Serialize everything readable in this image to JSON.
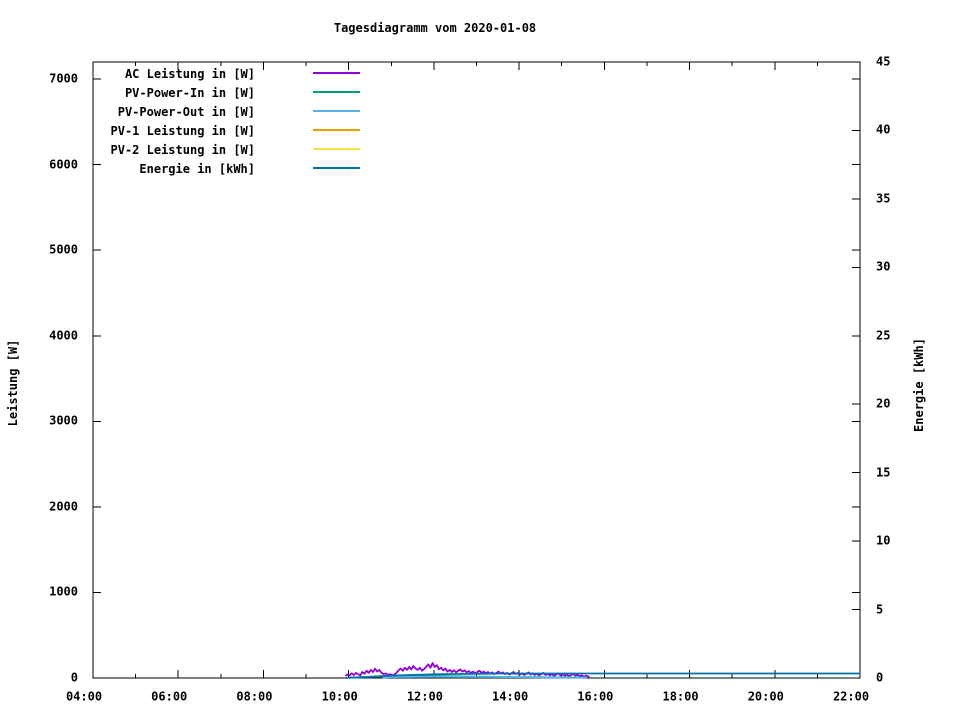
{
  "title": "Tagesdiagramm vom 2020-01-08",
  "axes": {
    "x": {
      "tick_labels": [
        "04:00",
        "06:00",
        "08:00",
        "10:00",
        "12:00",
        "14:00",
        "16:00",
        "18:00",
        "20:00",
        "22:00"
      ],
      "labeled_hours": [
        4,
        6,
        8,
        10,
        12,
        14,
        16,
        18,
        20,
        22
      ],
      "minor_hours": [
        5,
        7,
        9,
        11,
        13,
        15,
        17,
        19,
        21
      ],
      "range_hours": [
        4,
        22
      ]
    },
    "y_left": {
      "label": "Leistung [W]",
      "tick_labels": [
        "0",
        "1000",
        "2000",
        "3000",
        "4000",
        "5000",
        "6000",
        "7000"
      ],
      "tick_values": [
        0,
        1000,
        2000,
        3000,
        4000,
        5000,
        6000,
        7000
      ],
      "range": [
        0,
        7200
      ]
    },
    "y_right": {
      "label": "Energie [kWh]",
      "tick_labels": [
        "0",
        "5",
        "10",
        "15",
        "20",
        "25",
        "30",
        "35",
        "40",
        "45"
      ],
      "tick_values": [
        0,
        5,
        10,
        15,
        20,
        25,
        30,
        35,
        40,
        45
      ],
      "range": [
        0,
        45
      ]
    }
  },
  "colors": {
    "axis": "#000000",
    "background": "#ffffff",
    "ac": "#9400d3",
    "pv_in": "#009e73",
    "pv_out": "#56b4e9",
    "pv1": "#e69f00",
    "pv2": "#f0e442",
    "energie": "#0072b2"
  },
  "chart_data": {
    "type": "line",
    "title": "Tagesdiagramm vom 2020-01-08",
    "xlabel": "",
    "x_unit": "time of day (hours)",
    "xlim": [
      4,
      22
    ],
    "ylabel_left": "Leistung [W]",
    "ylim_left": [
      0,
      7200
    ],
    "ylabel_right": "Energie [kWh]",
    "ylim_right": [
      0,
      45
    ],
    "grid": false,
    "legend_position": "inside top-left",
    "series": [
      {
        "key": "ac",
        "name": "AC Leistung in [W]",
        "color": "#9400d3",
        "axis": "left",
        "points": [
          [
            9.92,
            25
          ],
          [
            9.97,
            40
          ],
          [
            10.02,
            30
          ],
          [
            10.07,
            55
          ],
          [
            10.12,
            35
          ],
          [
            10.17,
            60
          ],
          [
            10.22,
            45
          ],
          [
            10.27,
            30
          ],
          [
            10.32,
            70
          ],
          [
            10.37,
            50
          ],
          [
            10.42,
            85
          ],
          [
            10.47,
            60
          ],
          [
            10.52,
            95
          ],
          [
            10.57,
            70
          ],
          [
            10.62,
            110
          ],
          [
            10.67,
            75
          ],
          [
            10.72,
            95
          ],
          [
            10.77,
            60
          ],
          [
            10.82,
            45
          ],
          [
            10.87,
            55
          ],
          [
            10.92,
            35
          ],
          [
            10.97,
            45
          ],
          [
            11.02,
            30
          ],
          [
            11.07,
            40
          ],
          [
            11.12,
            60
          ],
          [
            11.17,
            90
          ],
          [
            11.22,
            110
          ],
          [
            11.27,
            85
          ],
          [
            11.32,
            120
          ],
          [
            11.37,
            95
          ],
          [
            11.42,
            130
          ],
          [
            11.47,
            100
          ],
          [
            11.52,
            140
          ],
          [
            11.57,
            110
          ],
          [
            11.62,
            95
          ],
          [
            11.67,
            120
          ],
          [
            11.72,
            85
          ],
          [
            11.77,
            105
          ],
          [
            11.82,
            130
          ],
          [
            11.87,
            160
          ],
          [
            11.92,
            120
          ],
          [
            11.97,
            175
          ],
          [
            12.02,
            130
          ],
          [
            12.07,
            150
          ],
          [
            12.12,
            100
          ],
          [
            12.17,
            120
          ],
          [
            12.22,
            90
          ],
          [
            12.27,
            110
          ],
          [
            12.32,
            75
          ],
          [
            12.37,
            95
          ],
          [
            12.42,
            70
          ],
          [
            12.47,
            90
          ],
          [
            12.52,
            65
          ],
          [
            12.57,
            85
          ],
          [
            12.62,
            100
          ],
          [
            12.67,
            75
          ],
          [
            12.72,
            90
          ],
          [
            12.77,
            65
          ],
          [
            12.82,
            80
          ],
          [
            12.87,
            60
          ],
          [
            12.92,
            75
          ],
          [
            12.97,
            55
          ],
          [
            13.02,
            70
          ],
          [
            13.07,
            85
          ],
          [
            13.12,
            60
          ],
          [
            13.17,
            75
          ],
          [
            13.22,
            55
          ],
          [
            13.27,
            70
          ],
          [
            13.32,
            50
          ],
          [
            13.37,
            65
          ],
          [
            13.42,
            45
          ],
          [
            13.47,
            60
          ],
          [
            13.52,
            75
          ],
          [
            13.57,
            50
          ],
          [
            13.62,
            65
          ],
          [
            13.67,
            45
          ],
          [
            13.72,
            60
          ],
          [
            13.77,
            40
          ],
          [
            13.82,
            55
          ],
          [
            13.87,
            70
          ],
          [
            13.92,
            45
          ],
          [
            13.97,
            60
          ],
          [
            14.02,
            40
          ],
          [
            14.07,
            55
          ],
          [
            14.12,
            35
          ],
          [
            14.17,
            50
          ],
          [
            14.22,
            65
          ],
          [
            14.27,
            40
          ],
          [
            14.32,
            55
          ],
          [
            14.37,
            35
          ],
          [
            14.42,
            50
          ],
          [
            14.47,
            30
          ],
          [
            14.52,
            45
          ],
          [
            14.57,
            60
          ],
          [
            14.62,
            35
          ],
          [
            14.67,
            50
          ],
          [
            14.72,
            30
          ],
          [
            14.77,
            45
          ],
          [
            14.82,
            25
          ],
          [
            14.87,
            40
          ],
          [
            14.92,
            55
          ],
          [
            14.97,
            30
          ],
          [
            15.02,
            45
          ],
          [
            15.07,
            25
          ],
          [
            15.12,
            40
          ],
          [
            15.17,
            20
          ],
          [
            15.22,
            35
          ],
          [
            15.27,
            50
          ],
          [
            15.32,
            25
          ],
          [
            15.37,
            40
          ],
          [
            15.42,
            20
          ],
          [
            15.47,
            30
          ],
          [
            15.52,
            15
          ],
          [
            15.57,
            25
          ],
          [
            15.62,
            18
          ],
          [
            15.65,
            12
          ]
        ]
      },
      {
        "key": "pv_in",
        "name": "PV-Power-In in [W]",
        "color": "#009e73",
        "axis": "left",
        "points": [
          [
            10.0,
            3
          ],
          [
            10.25,
            8
          ],
          [
            10.5,
            14
          ],
          [
            10.75,
            18
          ],
          [
            11.0,
            22
          ],
          [
            11.25,
            25
          ],
          [
            11.5,
            24
          ],
          [
            11.75,
            26
          ],
          [
            12.0,
            24
          ],
          [
            12.25,
            22
          ],
          [
            12.5,
            20
          ],
          [
            12.75,
            18
          ],
          [
            13.0,
            16
          ],
          [
            13.25,
            15
          ],
          [
            13.5,
            13
          ],
          [
            13.75,
            12
          ],
          [
            14.0,
            10
          ],
          [
            14.25,
            9
          ],
          [
            14.5,
            8
          ],
          [
            14.75,
            6
          ],
          [
            15.0,
            5
          ],
          [
            15.25,
            4
          ],
          [
            15.5,
            3
          ],
          [
            15.6,
            2
          ]
        ]
      },
      {
        "key": "pv_out",
        "name": "PV-Power-Out in [W]",
        "color": "#56b4e9",
        "axis": "left",
        "points": [
          [
            10.8,
            5
          ],
          [
            11.0,
            10
          ],
          [
            11.5,
            14
          ],
          [
            12.0,
            15
          ],
          [
            12.5,
            14
          ],
          [
            13.0,
            13
          ],
          [
            13.5,
            12
          ],
          [
            14.0,
            10
          ],
          [
            14.5,
            9
          ],
          [
            15.0,
            7
          ],
          [
            15.3,
            6
          ],
          [
            15.6,
            4
          ]
        ]
      },
      {
        "key": "pv1",
        "name": "PV-1 Leistung in [W]",
        "color": "#e69f00",
        "axis": "left",
        "points": []
      },
      {
        "key": "pv2",
        "name": "PV-2 Leistung in [W]",
        "color": "#f0e442",
        "axis": "left",
        "points": []
      },
      {
        "key": "energie",
        "name": "Energie in [kWh]",
        "color": "#0072b2",
        "axis": "right",
        "points": [
          [
            9.95,
            0.01
          ],
          [
            10.25,
            0.05
          ],
          [
            10.5,
            0.09
          ],
          [
            10.75,
            0.13
          ],
          [
            11.0,
            0.17
          ],
          [
            11.25,
            0.2
          ],
          [
            11.5,
            0.23
          ],
          [
            11.75,
            0.25
          ],
          [
            12.0,
            0.27
          ],
          [
            12.25,
            0.28
          ],
          [
            12.5,
            0.29
          ],
          [
            13.0,
            0.31
          ],
          [
            13.5,
            0.32
          ],
          [
            14.0,
            0.32
          ],
          [
            14.5,
            0.33
          ],
          [
            15.0,
            0.33
          ],
          [
            15.65,
            0.33
          ],
          [
            18.0,
            0.33
          ],
          [
            22.0,
            0.33
          ]
        ]
      }
    ]
  }
}
